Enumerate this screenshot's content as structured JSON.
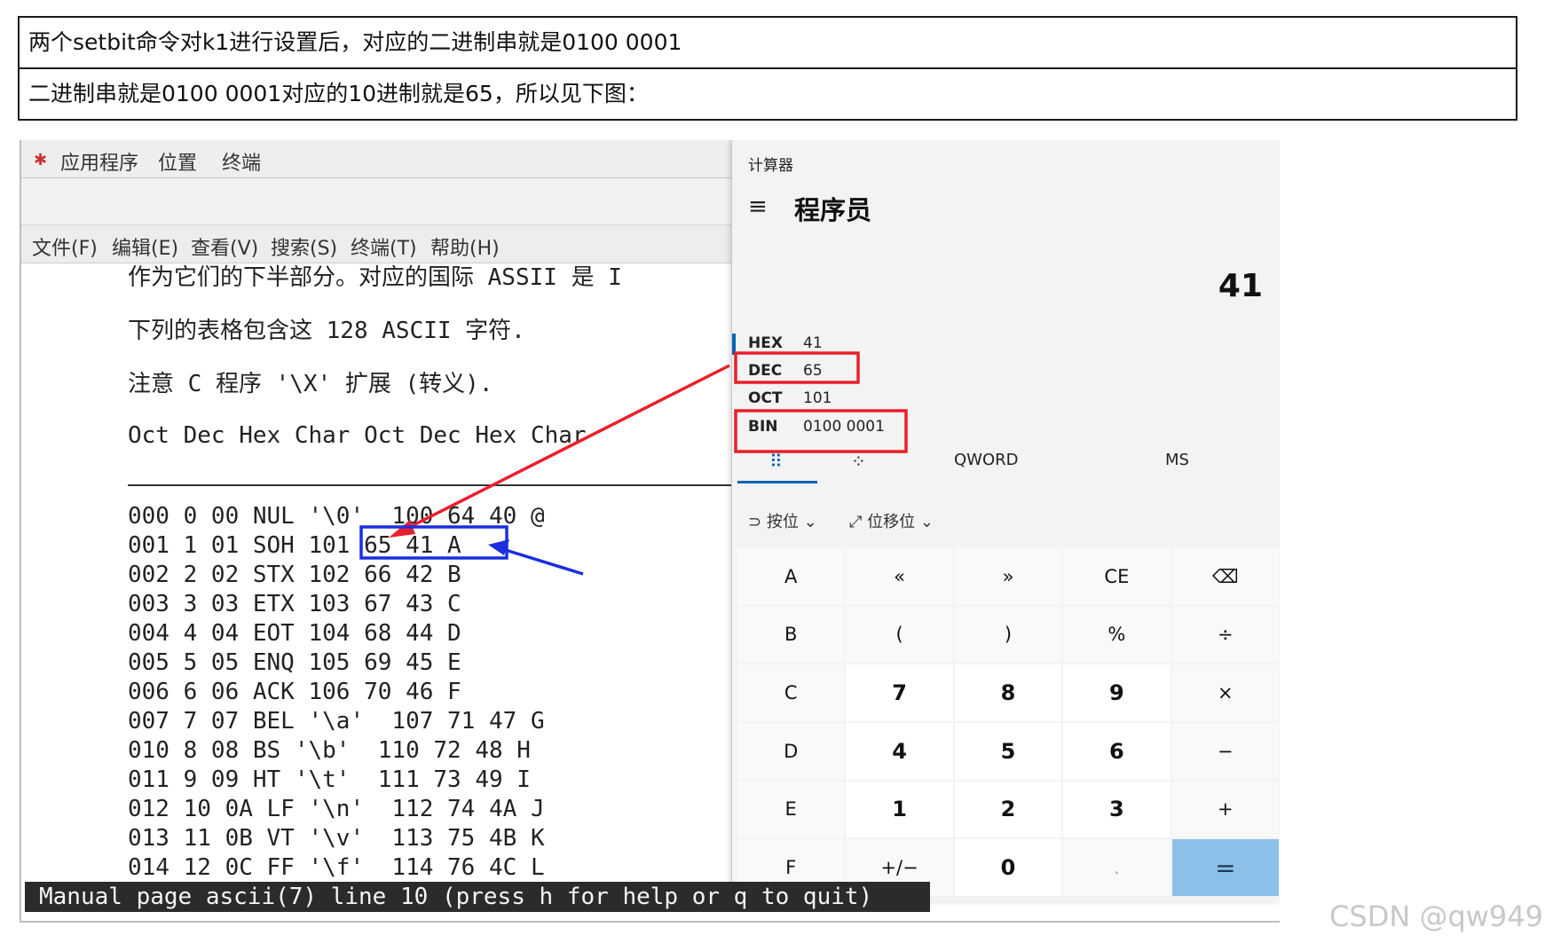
{
  "notes": [
    "两个setbit命令对k1进行设置后，对应的二进制串就是0100 0001",
    "二进制串就是0100 0001对应的10进制就是65，所以见下图："
  ],
  "terminal": {
    "gnome_menu": [
      "应用程序",
      "位置",
      "终端"
    ],
    "menu": [
      "文件(F)",
      "编辑(E)",
      "查看(V)",
      "搜索(S)",
      "终端(T)",
      "帮助(H)"
    ],
    "man_lines": [
      "作为它们的下半部分。对应的国际 ASSII 是 I",
      "下列的表格包含这 128 ASCII 字符.",
      "注意 C 程序 '\\X' 扩展 (转义).",
      "Oct Dec Hex Char Oct Dec Hex Char"
    ],
    "ascii_rows": [
      "000 0 00 NUL '\\0'  100 64 40 @",
      "001 1 01 SOH 101 65 41 A",
      "002 2 02 STX 102 66 42 B",
      "003 3 03 ETX 103 67 43 C",
      "004 4 04 EOT 104 68 44 D",
      "005 5 05 ENQ 105 69 45 E",
      "006 6 06 ACK 106 70 46 F",
      "007 7 07 BEL '\\a'  107 71 47 G",
      "010 8 08 BS '\\b'  110 72 48 H",
      "011 9 09 HT '\\t'  111 73 49 I",
      "012 10 0A LF '\\n'  112 74 4A J",
      "013 11 0B VT '\\v'  113 75 4B K",
      "014 12 0C FF '\\f'  114 76 4C L"
    ],
    "status": "Manual page ascii(7) line 10 (press h for help or q to quit)"
  },
  "calculator": {
    "title": "计算器",
    "mode": "程序员",
    "display": "41",
    "radix": [
      {
        "label": "HEX",
        "value": "41"
      },
      {
        "label": "DEC",
        "value": "65"
      },
      {
        "label": "OCT",
        "value": "101"
      },
      {
        "label": "BIN",
        "value": "0100 0001"
      }
    ],
    "tabs": {
      "word_size": "QWORD",
      "memory": "MS"
    },
    "ops": {
      "bitwise": "按位",
      "bitshift": "位移位"
    },
    "keys": [
      [
        "A",
        "«",
        "»",
        "CE",
        "⌫"
      ],
      [
        "B",
        "(",
        ")",
        "%",
        "÷"
      ],
      [
        "C",
        "7",
        "8",
        "9",
        "×"
      ],
      [
        "D",
        "4",
        "5",
        "6",
        "−"
      ],
      [
        "E",
        "1",
        "2",
        "3",
        "+"
      ],
      [
        "F",
        "+/−",
        "0",
        ".",
        "="
      ]
    ]
  },
  "annotation_colors": {
    "red": "#e8202a",
    "blue": "#1a2ee0"
  },
  "watermark": "CSDN @qw949"
}
